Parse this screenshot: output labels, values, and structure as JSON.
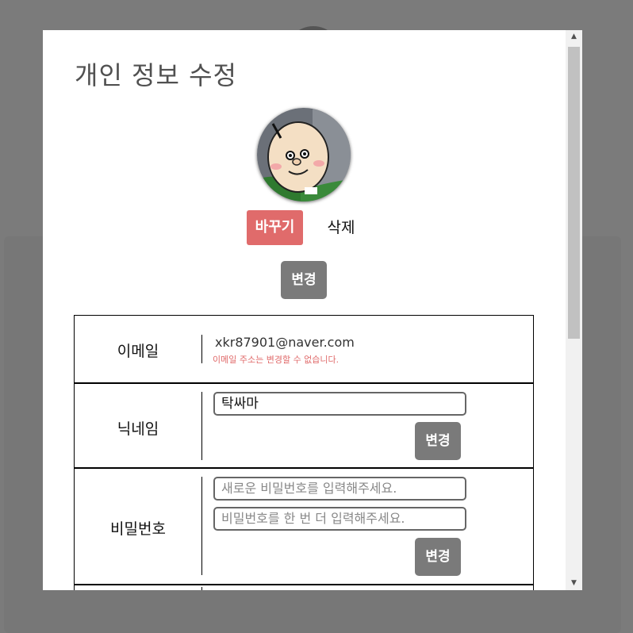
{
  "modal": {
    "title": "개인 정보 수정"
  },
  "profile_photo": {
    "change_label": "바꾸기",
    "delete_label": "삭제",
    "save_label": "변경"
  },
  "email_row": {
    "label": "이메일",
    "value": "xkr87901@naver.com",
    "note": "이메일 주소는 변경할 수 없습니다."
  },
  "nickname_row": {
    "label": "닉네임",
    "value": "탁싸마",
    "save_label": "변경"
  },
  "password_row": {
    "label": "비밀번호",
    "new_placeholder": "새로운 비밀번호를 입력해주세요.",
    "confirm_placeholder": "비밀번호를 한 번 더 입력해주세요.",
    "save_label": "변경"
  },
  "colors": {
    "accent": "#e06b6b",
    "button_gray": "#7a7a7a",
    "overlay": "#7b7b7b"
  },
  "icons": {
    "scroll_up": "scroll-up-arrow-icon",
    "scroll_down": "scroll-down-arrow-icon"
  }
}
